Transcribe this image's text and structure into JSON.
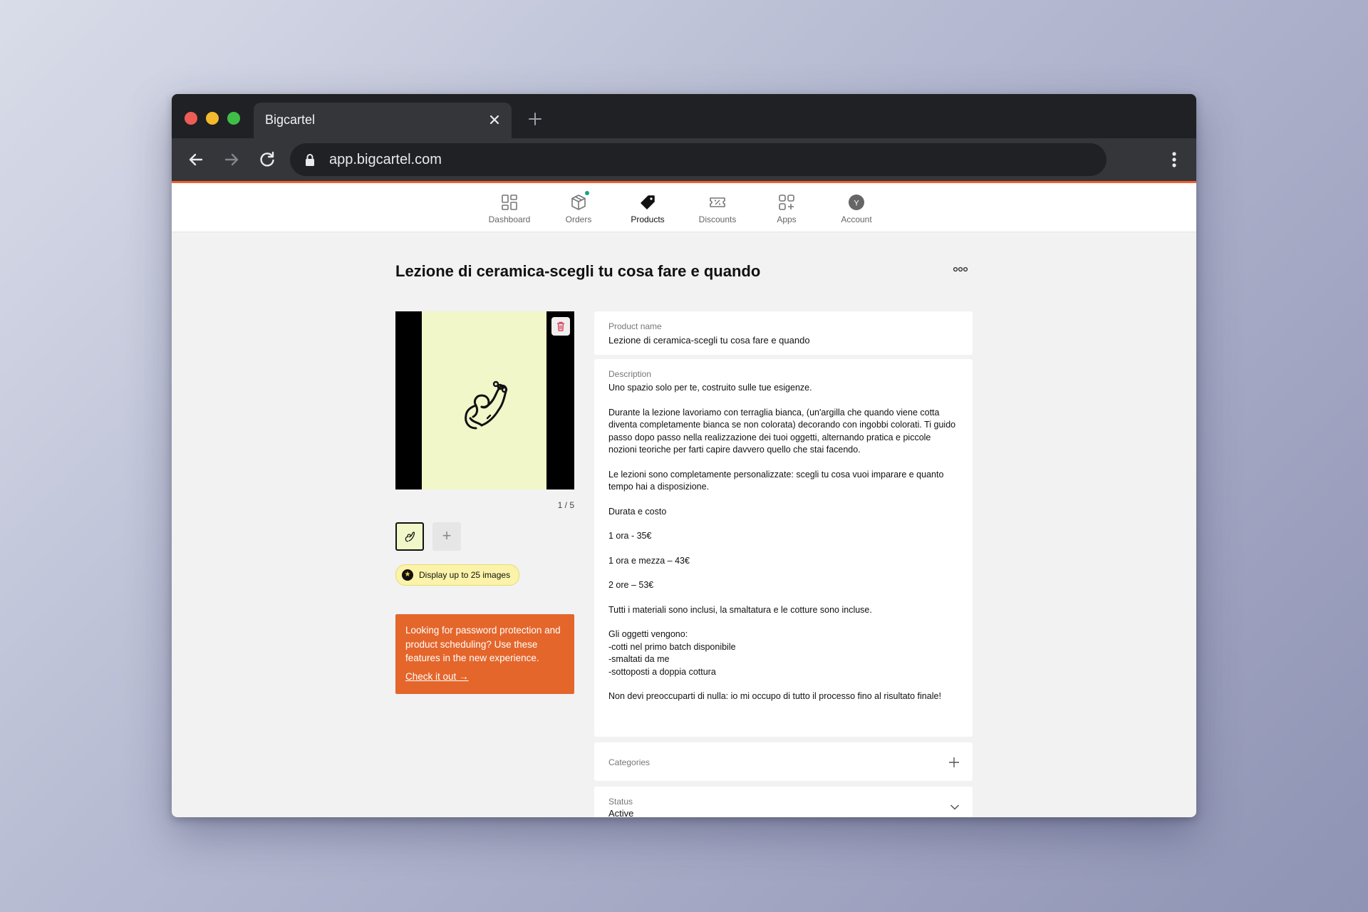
{
  "browser": {
    "tab_title": "Bigcartel",
    "url": "app.bigcartel.com"
  },
  "nav": {
    "items": [
      {
        "label": "Dashboard"
      },
      {
        "label": "Orders"
      },
      {
        "label": "Products"
      },
      {
        "label": "Discounts"
      },
      {
        "label": "Apps"
      },
      {
        "label": "Account"
      }
    ],
    "active": "Products",
    "account_initial": "Y"
  },
  "product": {
    "title": "Lezione di ceramica-scegli tu cosa fare e quando",
    "image_counter": "1 / 5",
    "images_pill": "Display up to 25 images",
    "promo": {
      "text": "Looking for password protection and product scheduling? Use these features in the new experience.",
      "link": "Check it out →"
    },
    "name_label": "Product name",
    "name_value": "Lezione di ceramica-scegli tu cosa fare e quando",
    "description_label": "Description",
    "description": {
      "p1": "Uno spazio solo per te, costruito sulle tue esigenze.",
      "p2": "Durante la lezione lavoriamo con terraglia bianca, (un'argilla che quando viene cotta diventa completamente bianca se non colorata) decorando con ingobbi colorati. Ti guido passo dopo passo nella realizzazione dei tuoi oggetti, alternando pratica e piccole nozioni teoriche per farti capire davvero quello che stai facendo.",
      "p3": "Le lezioni sono completamente personalizzate: scegli tu cosa vuoi imparare e quanto tempo hai a disposizione.",
      "p4": "Durata e costo",
      "p5": "1 ora - 35€",
      "p6": "1 ora e mezza – 43€",
      "p7": "2 ore – 53€",
      "p8": "Tutti i materiali sono inclusi, la smaltatura e le cotture sono incluse.",
      "p9_l1": "Gli oggetti vengono:",
      "p9_l2": "-cotti nel primo batch disponibile",
      "p9_l3": "-smaltati da me",
      "p9_l4": "-sottoposti a doppia cottura",
      "p10": "Non devi preoccuparti di nulla: io mi occupo di tutto il processo fino al risultato finale!"
    },
    "categories_label": "Categories",
    "status_label": "Status",
    "status_value": "Active"
  },
  "colors": {
    "accent": "#f05e2a",
    "promo": "#e4662b",
    "image_bg": "#f1f7c9",
    "pill": "#fbf3a9"
  }
}
